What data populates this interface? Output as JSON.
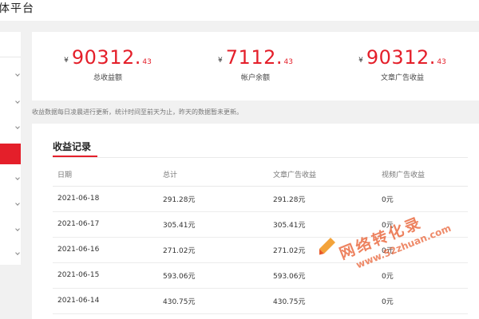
{
  "header": {
    "title": "体平台"
  },
  "sidebar": {
    "active_index": 3
  },
  "stats": [
    {
      "currency": "¥",
      "integer": "90312",
      "decimal": "43",
      "label": "总收益额"
    },
    {
      "currency": "¥",
      "integer": "7112",
      "decimal": "43",
      "label": "帐户余额"
    },
    {
      "currency": "¥",
      "integer": "90312",
      "decimal": "43",
      "label": "文章广告收益"
    }
  ],
  "note": "收益数据每日凌晨进行更新，统计时间至前天为止，昨天的数据暂未更新。",
  "records": {
    "title": "收益记录",
    "columns": [
      "日期",
      "总计",
      "文章广告收益",
      "视频广告收益"
    ],
    "rows": [
      [
        "2021-06-18",
        "291.28元",
        "291.28元",
        "0元"
      ],
      [
        "2021-06-17",
        "305.41元",
        "305.41元",
        "0元"
      ],
      [
        "2021-06-16",
        "271.02元",
        "271.02元",
        "0元"
      ],
      [
        "2021-06-15",
        "593.06元",
        "593.06元",
        "0元"
      ],
      [
        "2021-06-14",
        "430.75元",
        "430.75元",
        "0元"
      ]
    ]
  },
  "watermark": {
    "text": "网络转化录",
    "url": "www.52zhuan.com",
    "color": "#e8592a"
  },
  "colors": {
    "accent": "#e41f2a",
    "background": "#f1f1f1"
  }
}
